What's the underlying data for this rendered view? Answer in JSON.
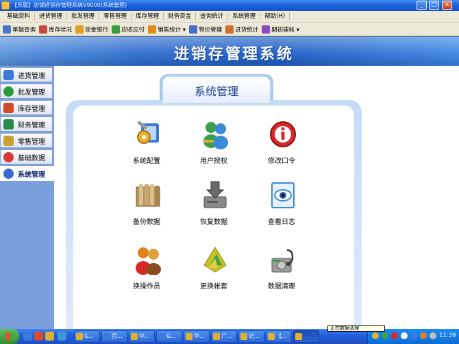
{
  "window": {
    "title": "【乐眉】店铺进销存管理系统V9000(系统管理)",
    "min_glyph": "_",
    "max_glyph": "□",
    "close_glyph": "×"
  },
  "menu": {
    "items": [
      {
        "label": "基础资料"
      },
      {
        "label": "进货管理"
      },
      {
        "label": "批发管理"
      },
      {
        "label": "零售管理"
      },
      {
        "label": "库存管理"
      },
      {
        "label": "财务资金"
      },
      {
        "label": "查询统计"
      },
      {
        "label": "系统管理"
      },
      {
        "label": "帮助(H)"
      }
    ]
  },
  "toolbar": {
    "items": [
      {
        "label": "单据查询",
        "icon": "document-search-icon",
        "color": "#4a78c8"
      },
      {
        "label": "库存状况",
        "icon": "warehouse-icon",
        "color": "#c84a3a"
      },
      {
        "label": "现金银行",
        "icon": "dollar-icon",
        "color": "#e0a020"
      },
      {
        "label": "应收应付",
        "icon": "money-icon",
        "color": "#3a9a3a"
      },
      {
        "label": "销售统计 ▾",
        "icon": "sales-chart-icon",
        "color": "#e08a20"
      },
      {
        "label": "物价管理",
        "icon": "price-tag-icon",
        "color": "#4a6ac8"
      },
      {
        "label": "进货统计",
        "icon": "purchase-icon",
        "color": "#d07030"
      },
      {
        "label": "期初建帐 ▾",
        "icon": "ledger-icon",
        "color": "#8a4ac0"
      }
    ]
  },
  "banner": {
    "title": "进销存管理系统"
  },
  "sidebar": {
    "items": [
      {
        "label": "进货管理",
        "icon": "purchase-icon",
        "color": "#3a7ad8",
        "active": false
      },
      {
        "label": "批发管理",
        "icon": "check-circle-icon",
        "color": "#2a9a3a",
        "active": false
      },
      {
        "label": "库存管理",
        "icon": "house-icon",
        "color": "#d04a2a",
        "active": false
      },
      {
        "label": "财务管理",
        "icon": "dollar-icon",
        "color": "#2a8a4a",
        "active": false
      },
      {
        "label": "零售管理",
        "icon": "retail-icon",
        "color": "#c8a030",
        "active": false
      },
      {
        "label": "基础数据",
        "icon": "lifebuoy-icon",
        "color": "#d83a3a",
        "active": false
      },
      {
        "label": "系统管理",
        "icon": "gear-icon",
        "color": "#3a6ad0",
        "active": true
      }
    ]
  },
  "main": {
    "tab_title": "系统管理",
    "items": [
      {
        "label": "系统配置",
        "icon": "system-config-icon",
        "color": "#3a7ad8"
      },
      {
        "label": "用户授权",
        "icon": "user-authorize-icon",
        "color": "#3aa04a"
      },
      {
        "label": "修改口令",
        "icon": "info-icon",
        "color": "#d8282a"
      },
      {
        "label": "备份数据",
        "icon": "archive-box-icon",
        "color": "#b8955a"
      },
      {
        "label": "恢复数据",
        "icon": "restore-drive-icon",
        "color": "#7a7a7a"
      },
      {
        "label": "查看日志",
        "icon": "log-eye-icon",
        "color": "#3a8ad8"
      },
      {
        "label": "换操作员",
        "icon": "switch-user-icon",
        "color": "#e0801a"
      },
      {
        "label": "更换帐套",
        "icon": "change-ledger-icon",
        "color": "#c8c020"
      },
      {
        "label": "数据清理",
        "icon": "data-clean-icon",
        "color": "#8a8a8a"
      }
    ]
  },
  "taskbar": {
    "buttons": [
      {
        "label": "G...",
        "color": "#e0b030"
      },
      {
        "label": "百...",
        "color": "#3a7ad8"
      },
      {
        "label": "华...",
        "color": "#e0b030"
      },
      {
        "label": "G...",
        "color": "#3a7ad8"
      },
      {
        "label": "华...",
        "color": "#e0b030"
      },
      {
        "label": "广...",
        "color": "#e0b030"
      },
      {
        "label": "记...",
        "color": "#e0b030"
      },
      {
        "label": "【...",
        "color": "#e0b030"
      }
    ],
    "clock": "11:39",
    "balloon": "正在数据清理"
  },
  "colors": {
    "accent": "#245edb",
    "sidebar_bg": "#7b9fdc",
    "banner": "#2f6fce"
  }
}
